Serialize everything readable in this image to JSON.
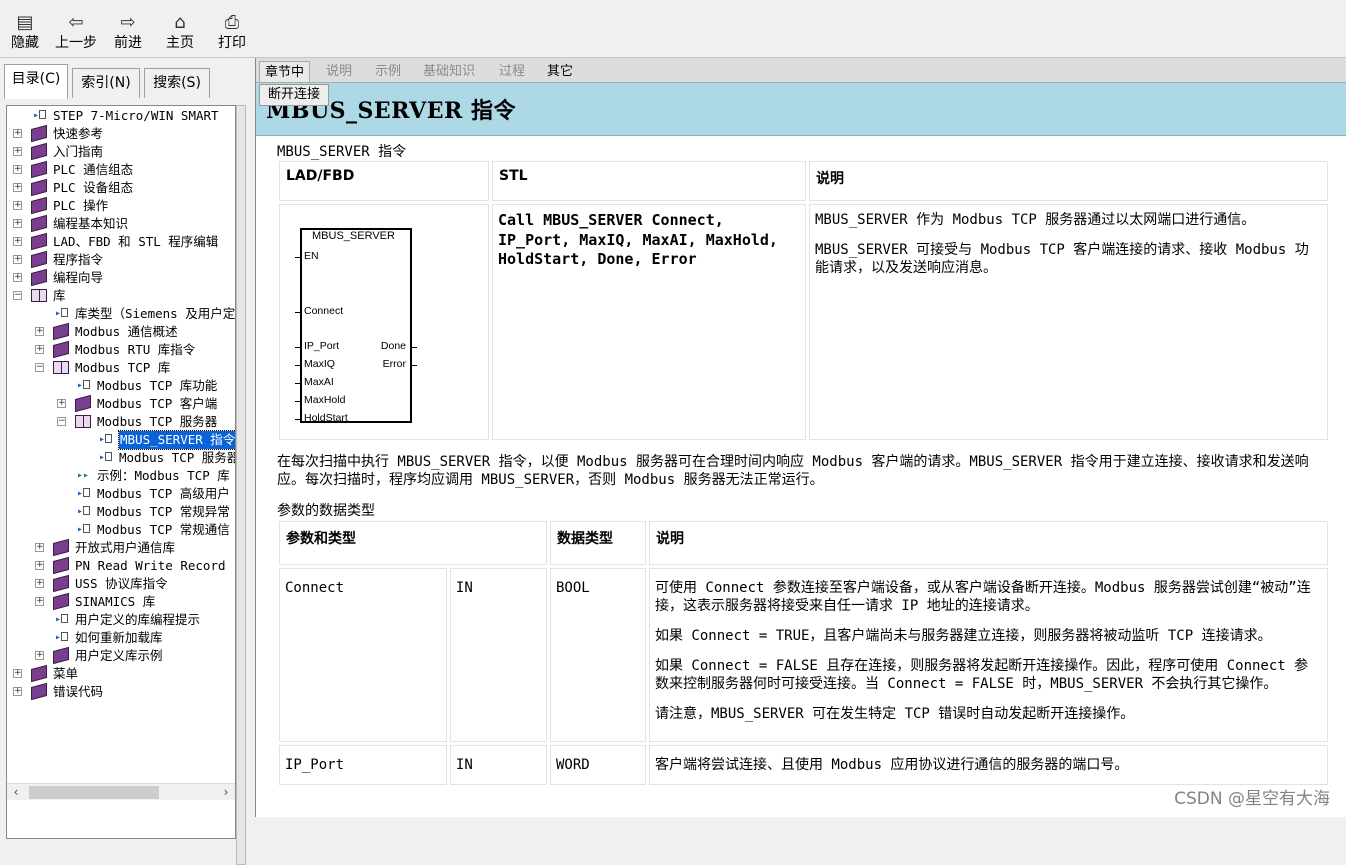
{
  "toolbar": {
    "buttons": [
      {
        "label": "隐藏",
        "icon": "hide-icon"
      },
      {
        "label": "上一步",
        "icon": "back-arrow-icon"
      },
      {
        "label": "前进",
        "icon": "forward-arrow-icon"
      },
      {
        "label": "主页",
        "icon": "home-icon"
      },
      {
        "label": "打印",
        "icon": "print-icon"
      }
    ]
  },
  "left_tabs": [
    "目录(C)",
    "索引(N)",
    "搜索(S)"
  ],
  "tree": [
    {
      "depth": 0,
      "kind": "page",
      "label": "STEP 7-Micro/WIN SMART"
    },
    {
      "depth": 0,
      "kind": "book",
      "expander": "+",
      "label": "快速参考"
    },
    {
      "depth": 0,
      "kind": "book",
      "expander": "+",
      "label": "入门指南"
    },
    {
      "depth": 0,
      "kind": "book",
      "expander": "+",
      "label": "PLC 通信组态"
    },
    {
      "depth": 0,
      "kind": "book",
      "expander": "+",
      "label": "PLC 设备组态"
    },
    {
      "depth": 0,
      "kind": "book",
      "expander": "+",
      "label": "PLC 操作"
    },
    {
      "depth": 0,
      "kind": "book",
      "expander": "+",
      "label": "编程基本知识"
    },
    {
      "depth": 0,
      "kind": "book",
      "expander": "+",
      "label": "LAD、FBD 和 STL 程序编辑"
    },
    {
      "depth": 0,
      "kind": "book",
      "expander": "+",
      "label": "程序指令"
    },
    {
      "depth": 0,
      "kind": "book",
      "expander": "+",
      "label": "编程向导"
    },
    {
      "depth": 0,
      "kind": "openbook",
      "expander": "−",
      "label": "库"
    },
    {
      "depth": 1,
      "kind": "page",
      "label": "库类型（Siemens 及用户定义）"
    },
    {
      "depth": 1,
      "kind": "book",
      "expander": "+",
      "label": "Modbus 通信概述"
    },
    {
      "depth": 1,
      "kind": "book",
      "expander": "+",
      "label": "Modbus RTU 库指令"
    },
    {
      "depth": 1,
      "kind": "openbook",
      "expander": "−",
      "label": "Modbus TCP 库"
    },
    {
      "depth": 2,
      "kind": "page",
      "label": "Modbus TCP 库功能"
    },
    {
      "depth": 2,
      "kind": "book",
      "expander": "+",
      "label": "Modbus TCP 客户端"
    },
    {
      "depth": 2,
      "kind": "openbook",
      "expander": "−",
      "label": "Modbus TCP 服务器"
    },
    {
      "depth": 3,
      "kind": "page",
      "label": "MBUS_SERVER 指令",
      "selected": true
    },
    {
      "depth": 3,
      "kind": "page",
      "label": "Modbus TCP 服务器示例"
    },
    {
      "depth": 2,
      "kind": "example",
      "label": "示例：Modbus TCP 库"
    },
    {
      "depth": 2,
      "kind": "page",
      "label": "Modbus TCP 高级用户"
    },
    {
      "depth": 2,
      "kind": "page",
      "label": "Modbus TCP 常规异常"
    },
    {
      "depth": 2,
      "kind": "page",
      "label": "Modbus TCP 常规通信"
    },
    {
      "depth": 1,
      "kind": "book",
      "expander": "+",
      "label": "开放式用户通信库"
    },
    {
      "depth": 1,
      "kind": "book",
      "expander": "+",
      "label": "PN Read Write Record"
    },
    {
      "depth": 1,
      "kind": "book",
      "expander": "+",
      "label": "USS 协议库指令"
    },
    {
      "depth": 1,
      "kind": "book",
      "expander": "+",
      "label": "SINAMICS 库"
    },
    {
      "depth": 1,
      "kind": "page",
      "label": "用户定义的库编程提示"
    },
    {
      "depth": 1,
      "kind": "page",
      "label": "如何重新加载库"
    },
    {
      "depth": 1,
      "kind": "book",
      "expander": "+",
      "label": "用户定义库示例"
    },
    {
      "depth": 0,
      "kind": "book",
      "expander": "+",
      "label": "菜单"
    },
    {
      "depth": 0,
      "kind": "book",
      "expander": "+",
      "label": "错误代码"
    }
  ],
  "content_tabs": [
    "章节中",
    "说明",
    "示例",
    "基础知识",
    "过程",
    "其它"
  ],
  "popup_label": "断开连接",
  "page_title": "MBUS_SERVER 指令",
  "subtitle": "MBUS_SERVER 指令",
  "instr_table": {
    "headers": [
      "LAD/FBD",
      "STL",
      "说明"
    ],
    "stl": "Call MBUS_SERVER Connect, IP_Port, MaxIQ, MaxAI, MaxHold, HoldStart, Done, Error",
    "desc": [
      "MBUS_SERVER 作为 Modbus TCP 服务器通过以太网端口进行通信。",
      "MBUS_SERVER 可接受与 Modbus TCP 客户端连接的请求、接收 Modbus 功能请求，以及发送响应消息。"
    ],
    "fbd": {
      "name": "MBUS_SERVER",
      "inputs": [
        "EN",
        "Connect",
        "IP_Port",
        "MaxIQ",
        "MaxAI",
        "MaxHold",
        "HoldStart"
      ],
      "outputs": [
        "Done",
        "Error"
      ]
    }
  },
  "para1": "在每次扫描中执行 MBUS_SERVER 指令，以便 Modbus 服务器可在合理时间内响应 Modbus 客户端的请求。MBUS_SERVER 指令用于建立连接、接收请求和发送响应。每次扫描时，程序均应调用 MBUS_SERVER，否则 Modbus 服务器无法正常运行。",
  "param_caption": "参数的数据类型",
  "param_table": {
    "headers": [
      "参数和类型",
      "数据类型",
      "说明"
    ],
    "rows": [
      {
        "name": "Connect",
        "dir": "IN",
        "type": "BOOL",
        "desc": [
          "可使用 Connect 参数连接至客户端设备，或从客户端设备断开连接。Modbus 服务器尝试创建“被动”连接，这表示服务器将接受来自任一请求 IP 地址的连接请求。",
          "如果 Connect = TRUE，且客户端尚未与服务器建立连接，则服务器将被动监听 TCP 连接请求。",
          "如果 Connect = FALSE 且存在连接，则服务器将发起断开连接操作。因此，程序可使用 Connect 参数来控制服务器何时可接受连接。当 Connect = FALSE 时，MBUS_SERVER 不会执行其它操作。",
          "请注意，MBUS_SERVER 可在发生特定 TCP 错误时自动发起断开连接操作。"
        ]
      },
      {
        "name": "IP_Port",
        "dir": "IN",
        "type": "WORD",
        "desc": [
          "客户端将尝试连接、且使用 Modbus 应用协议进行通信的服务器的端口号。"
        ]
      }
    ]
  },
  "watermark": "CSDN @星空有大海"
}
